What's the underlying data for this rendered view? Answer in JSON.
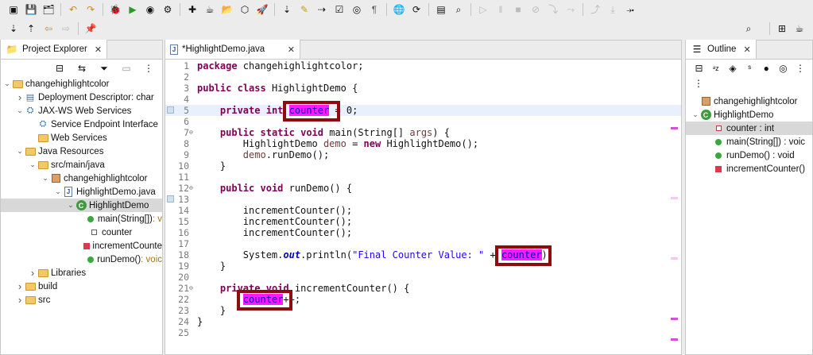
{
  "toolbar": {
    "row1": [
      "new-icon",
      "save-icon",
      "save-all-icon",
      "undo-icon",
      "redo-icon",
      "debug-icon",
      "run-icon",
      "run-coverage-icon",
      "external-tools-icon",
      "new-wizard-icon",
      "new-java-project-icon",
      "open-folder-icon",
      "open-type-icon",
      "launch-icon",
      "next-annotation-icon",
      "highlighter-icon",
      "step-icon",
      "open-task-icon",
      "toggle-breakpoint-icon",
      "paragraph-icon",
      "web-browser-icon",
      "run-last-icon",
      "console-icon",
      "search-icon",
      "resume-icon",
      "suspend-icon",
      "terminate-icon",
      "disconnect-icon",
      "step-into-icon",
      "step-over-icon",
      "step-return-icon",
      "drop-to-frame-icon",
      "use-step-filters-icon"
    ],
    "row2": [
      "next-edit-icon",
      "prev-edit-icon",
      "back-icon",
      "forward-icon",
      "pin-editor-icon"
    ],
    "search_icon": "search-icon",
    "perspective_icons": [
      "open-perspective-icon",
      "java-ee-perspective-icon"
    ]
  },
  "explorer": {
    "title": "Project Explorer",
    "tree": [
      {
        "label": "changehighlightcolor",
        "icon": "project-icon",
        "twisty": "open",
        "depth": 0
      },
      {
        "label": "Deployment Descriptor: char",
        "icon": "descriptor-icon",
        "twisty": "closed",
        "depth": 1
      },
      {
        "label": "JAX-WS Web Services",
        "icon": "webservice-icon",
        "twisty": "open",
        "depth": 1
      },
      {
        "label": "Service Endpoint Interface",
        "icon": "endpoint-icon",
        "twisty": "",
        "depth": 2
      },
      {
        "label": "Web Services",
        "icon": "webservices-icon",
        "twisty": "",
        "depth": 2
      },
      {
        "label": "Java Resources",
        "icon": "java-resources-icon",
        "twisty": "open",
        "depth": 1
      },
      {
        "label": "src/main/java",
        "icon": "source-folder-icon",
        "twisty": "open",
        "depth": 2
      },
      {
        "label": "changehighlightcolor",
        "icon": "package-icon",
        "twisty": "open",
        "depth": 3
      },
      {
        "label": "HighlightDemo.java",
        "icon": "java-file-icon",
        "twisty": "open",
        "depth": 4
      },
      {
        "label": "HighlightDemo",
        "icon": "class-icon",
        "twisty": "open",
        "depth": 5,
        "selected": true
      },
      {
        "label": "main(String[])",
        "suffix": " : v",
        "icon": "public-static-method-icon",
        "twisty": "",
        "depth": 6
      },
      {
        "label": "counter",
        "icon": "private-field-icon",
        "twisty": "",
        "depth": 6
      },
      {
        "label": "incrementCounte",
        "icon": "private-method-icon",
        "twisty": "",
        "depth": 6
      },
      {
        "label": "runDemo()",
        "suffix": " : voic",
        "icon": "public-method-icon",
        "twisty": "",
        "depth": 6
      },
      {
        "label": "Libraries",
        "icon": "libraries-icon",
        "twisty": "closed",
        "depth": 2
      },
      {
        "label": "build",
        "icon": "folder-icon",
        "twisty": "closed",
        "depth": 1
      },
      {
        "label": "src",
        "icon": "folder-icon",
        "twisty": "closed",
        "depth": 1
      }
    ]
  },
  "editor": {
    "tab_title": "*HighlightDemo.java",
    "lines": [
      {
        "n": "1",
        "html": "<span class='kw'>package</span> changehighlightcolor;"
      },
      {
        "n": "2",
        "html": ""
      },
      {
        "n": "3",
        "html": "<span class='kw'>public</span> <span class='kw'>class</span> HighlightDemo {"
      },
      {
        "n": "4",
        "html": ""
      },
      {
        "n": "5",
        "html": "    <span class='kw'>private</span> <span class='kw'>int</span> <span class='hl'>counter</span> = 0;",
        "current": true,
        "gutter": true
      },
      {
        "n": "6",
        "html": ""
      },
      {
        "n": "7",
        "html": "    <span class='kw'>public</span> <span class='kw'>static</span> <span class='kw'>void</span> main(String[] <span class='var'>args</span>) {",
        "fold": true
      },
      {
        "n": "8",
        "html": "        HighlightDemo <span class='var'>demo</span> = <span class='kw'>new</span> HighlightDemo();"
      },
      {
        "n": "9",
        "html": "        <span class='var'>demo</span>.runDemo();"
      },
      {
        "n": "10",
        "html": "    }"
      },
      {
        "n": "11",
        "html": ""
      },
      {
        "n": "12",
        "html": "    <span class='kw'>public</span> <span class='kw'>void</span> runDemo() {",
        "fold": true
      },
      {
        "n": "13",
        "html": "",
        "gutter": true
      },
      {
        "n": "14",
        "html": "        incrementCounter();"
      },
      {
        "n": "15",
        "html": "        incrementCounter();"
      },
      {
        "n": "16",
        "html": "        incrementCounter();"
      },
      {
        "n": "17",
        "html": ""
      },
      {
        "n": "18",
        "html": "        System.<span class='st'>out</span>.println(<span class='str'>\"Final Counter Value: \"</span> + <span class='hl'>counter</span>);"
      },
      {
        "n": "19",
        "html": "    }"
      },
      {
        "n": "20",
        "html": ""
      },
      {
        "n": "21",
        "html": "    <span class='kw'>private</span> <span class='kw'>void</span> incrementCounter() {",
        "fold": true
      },
      {
        "n": "22",
        "html": "        <span class='hl'>counter</span>++;"
      },
      {
        "n": "23",
        "html": "    }"
      },
      {
        "n": "24",
        "html": "}"
      },
      {
        "n": "25",
        "html": ""
      }
    ]
  },
  "outline": {
    "title": "Outline",
    "items": [
      {
        "label": "changehighlightcolor",
        "icon": "package-icon",
        "twisty": "",
        "depth": 0
      },
      {
        "label": "HighlightDemo",
        "icon": "class-icon",
        "twisty": "open",
        "depth": 0
      },
      {
        "label": "counter : int",
        "icon": "private-field-icon",
        "twisty": "",
        "depth": 1,
        "selected": true
      },
      {
        "label": "main(String[]) : voic",
        "icon": "public-static-method-icon",
        "twisty": "",
        "depth": 1
      },
      {
        "label": "runDemo() : void",
        "icon": "public-method-icon",
        "twisty": "",
        "depth": 1
      },
      {
        "label": "incrementCounter()",
        "icon": "private-method-icon",
        "twisty": "",
        "depth": 1
      }
    ]
  },
  "colors": {
    "occurrence_highlight": "#ff19ff",
    "annotation_box": "#8e0b10",
    "current_line": "#e7f0fb",
    "keyword": "#7f0055"
  }
}
